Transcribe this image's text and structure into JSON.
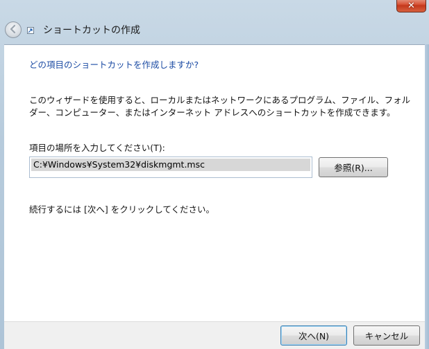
{
  "window": {
    "close_label": "✕"
  },
  "header": {
    "title": "ショートカットの作成",
    "back_icon": "back-arrow-icon",
    "app_icon": "shortcut-icon"
  },
  "content": {
    "question": "どの項目のショートカットを作成しますか?",
    "description": "このウィザードを使用すると、ローカルまたはネットワークにあるプログラム、ファイル、フォルダー、コンピューター、またはインターネット アドレスへのショートカットを作成できます。",
    "path_label": "項目の場所を入力してください(T):",
    "path_value": "C:¥Windows¥System32¥diskmgmt.msc",
    "browse_label": "参照(R)...",
    "continue_text": "続行するには [次へ] をクリックしてください。"
  },
  "footer": {
    "next_label": "次へ(N)",
    "cancel_label": "キャンセル"
  },
  "colors": {
    "question_text": "#1a4aa3",
    "close_button": "#c4381c"
  }
}
